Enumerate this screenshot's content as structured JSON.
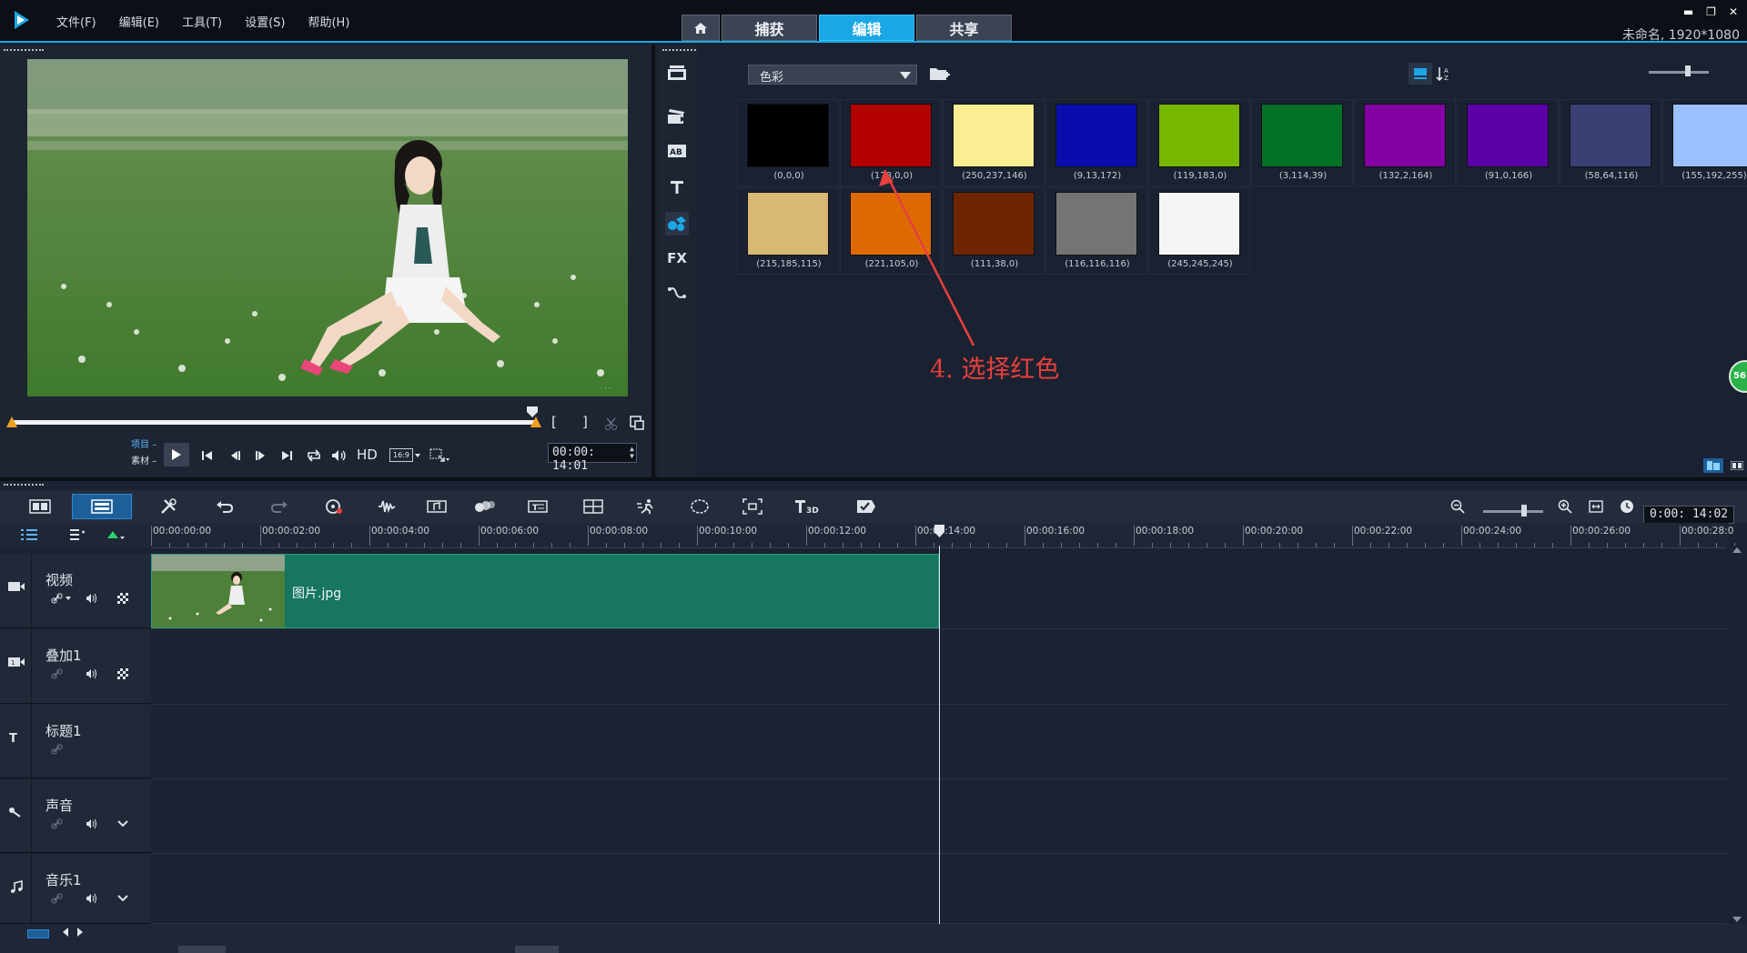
{
  "menu": {
    "items": [
      "文件(F)",
      "编辑(E)",
      "工具(T)",
      "设置(S)",
      "帮助(H)"
    ]
  },
  "mode_tabs": {
    "capture": "捕获",
    "edit": "编辑",
    "share": "共享",
    "active": "edit"
  },
  "project_info": "未命名, 1920*1080",
  "player": {
    "project_label": "项目",
    "clip_label": "素材",
    "hd_label": "HD",
    "aspect_ratio": "16:9",
    "timecode": "00:00: 14:01",
    "mark_in": "[",
    "mark_out": "]"
  },
  "library": {
    "category": "色彩",
    "swatches": [
      {
        "label": "(0,0,0)",
        "color": "#000000"
      },
      {
        "label": "(178,0,0)",
        "color": "#b20000"
      },
      {
        "label": "(250,237,146)",
        "color": "#faed92"
      },
      {
        "label": "(9,13,172)",
        "color": "#090dac"
      },
      {
        "label": "(119,183,0)",
        "color": "#77b700"
      },
      {
        "label": "(3,114,39)",
        "color": "#037227"
      },
      {
        "label": "(132,2,164)",
        "color": "#8402a4"
      },
      {
        "label": "(91,0,166)",
        "color": "#5b00a6"
      },
      {
        "label": "(58,64,116)",
        "color": "#3a4074"
      },
      {
        "label": "(155,192,255)",
        "color": "#9bc0ff"
      },
      {
        "label": "(215,185,115)",
        "color": "#d7b973"
      },
      {
        "label": "(221,105,0)",
        "color": "#dd6900"
      },
      {
        "label": "(111,38,0)",
        "color": "#6f2600"
      },
      {
        "label": "(116,116,116)",
        "color": "#747474"
      },
      {
        "label": "(245,245,245)",
        "color": "#f5f5f5"
      }
    ],
    "annotation": "4. 选择红色",
    "bubble_text": "56"
  },
  "timeline": {
    "timecode": "0:00: 14:02",
    "ruler_ticks": [
      "00:00:00:00",
      "00:00:02:00",
      "00:00:04:00",
      "00:00:06:00",
      "00:00:08:00",
      "00:00:10:00",
      "00:00:12:00",
      "00:00:14:00",
      "00:00:16:00",
      "00:00:18:00",
      "00:00:20:00",
      "00:00:22:00",
      "00:00:24:00",
      "00:00:26:00",
      "00:00:28:0"
    ],
    "tracks": [
      {
        "name": "视频",
        "type": "video"
      },
      {
        "name": "叠加1",
        "type": "overlay"
      },
      {
        "name": "标题1",
        "type": "title"
      },
      {
        "name": "声音",
        "type": "voice"
      },
      {
        "name": "音乐1",
        "type": "music"
      }
    ],
    "clip": {
      "name": "图片.jpg"
    }
  },
  "colors": {
    "accent": "#1aa7e6",
    "clip": "#16765f",
    "annotation": "#e8403d"
  }
}
